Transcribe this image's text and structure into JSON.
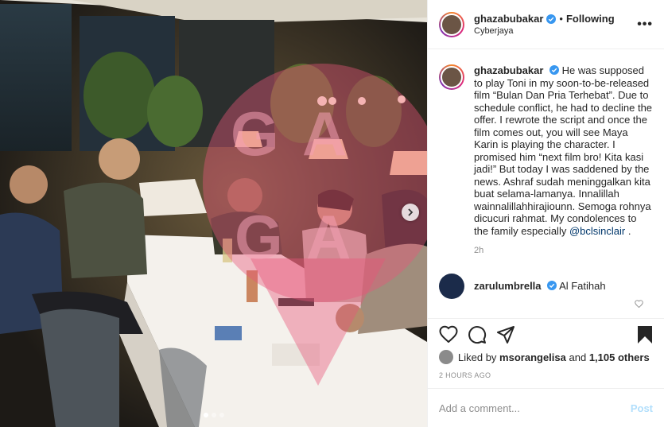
{
  "post": {
    "author": "ghazabubakar",
    "follow_separator": "•",
    "follow_status": "Following",
    "location": "Cyberjaya",
    "more_label": "•••",
    "caption": {
      "author": "ghazabubakar",
      "text": "He was supposed to play Toni in my soon-to-be-released film “Bulan Dan Pria Terhebat”. Due to schedule conflict, he had to decline the offer. I rewrote the script and once the film comes out, you will see Maya Karin is playing the character. I promised him “next film bro! Kita kasi jadi!” But today I was saddened by the news. Ashraf sudah meninggalkan kita buat selama-lamanya. Innalillah wainnalillahhirajiounn. Semoga rohnya dicucuri rahmat. My condolences to the family especially",
      "mention": "@bclsinclair",
      "end": " .",
      "time": "2h"
    },
    "comments": [
      {
        "author": "zarulumbrella",
        "text": "Al Fatihah"
      }
    ],
    "likes": {
      "prefix": "Liked by",
      "user": "msorangelisa",
      "and": "and",
      "others": "1,105 others"
    },
    "posted_ago": "2 HOURS AGO",
    "comment_input": {
      "placeholder": "Add a comment..."
    },
    "post_button": "Post"
  },
  "icons": [
    "verified-badge-icon",
    "heart-icon",
    "comment-icon",
    "share-icon",
    "bookmark-icon",
    "next-arrow-icon"
  ],
  "colors": {
    "verified": "#3897f0",
    "link": "#00376b",
    "post_button_disabled": "#b2dffc",
    "watermark": "#e6557a"
  },
  "carousel": {
    "slides": 3,
    "active": 0
  }
}
